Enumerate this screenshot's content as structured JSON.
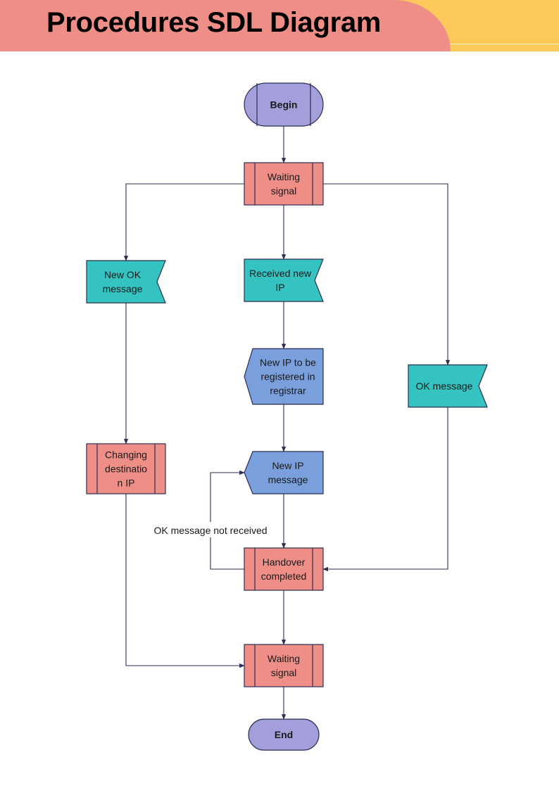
{
  "header": {
    "title": "Procedures SDL Diagram",
    "colors": {
      "primary": "#ef8d87",
      "secondary": "#fdc95a"
    }
  },
  "diagram": {
    "colors": {
      "terminal": "#a29fdb",
      "process": "#ef8d87",
      "input": "#34c3c1",
      "output": "#7a9fdd",
      "stroke": "#2b2d52"
    },
    "nodes": [
      {
        "id": "begin",
        "type": "terminal-start",
        "label": [
          "Begin"
        ]
      },
      {
        "id": "waiting1",
        "type": "process",
        "label": [
          "Waiting",
          "signal"
        ]
      },
      {
        "id": "new-ok-message",
        "type": "input",
        "label": [
          "New OK",
          "message"
        ]
      },
      {
        "id": "received-new-ip",
        "type": "input",
        "label": [
          "Received new",
          "IP"
        ]
      },
      {
        "id": "new-ip-registered",
        "type": "output",
        "label": [
          "New IP to be",
          "registered in",
          "registrar"
        ]
      },
      {
        "id": "ok-message",
        "type": "input",
        "label": [
          "OK message"
        ]
      },
      {
        "id": "changing-destination",
        "type": "process",
        "label": [
          "Changing",
          "destinatio",
          "n IP"
        ]
      },
      {
        "id": "new-ip-message",
        "type": "output",
        "label": [
          "New IP",
          "message"
        ]
      },
      {
        "id": "handover-completed",
        "type": "process",
        "label": [
          "Handover",
          "completed"
        ]
      },
      {
        "id": "waiting2",
        "type": "process",
        "label": [
          "Waiting",
          "signal"
        ]
      },
      {
        "id": "end",
        "type": "terminal-end",
        "label": [
          "End"
        ]
      }
    ],
    "edges": [
      {
        "from": "begin",
        "to": "waiting1"
      },
      {
        "from": "waiting1",
        "to": "new-ok-message"
      },
      {
        "from": "waiting1",
        "to": "received-new-ip"
      },
      {
        "from": "waiting1",
        "to": "ok-message"
      },
      {
        "from": "received-new-ip",
        "to": "new-ip-registered"
      },
      {
        "from": "new-ip-registered",
        "to": "new-ip-message"
      },
      {
        "from": "new-ok-message",
        "to": "changing-destination"
      },
      {
        "from": "new-ip-message",
        "to": "handover-completed"
      },
      {
        "from": "handover-completed",
        "to": "new-ip-message",
        "label": "OK message not received"
      },
      {
        "from": "ok-message",
        "to": "handover-completed"
      },
      {
        "from": "handover-completed",
        "to": "waiting2"
      },
      {
        "from": "changing-destination",
        "to": "waiting2"
      },
      {
        "from": "waiting2",
        "to": "end"
      }
    ]
  }
}
